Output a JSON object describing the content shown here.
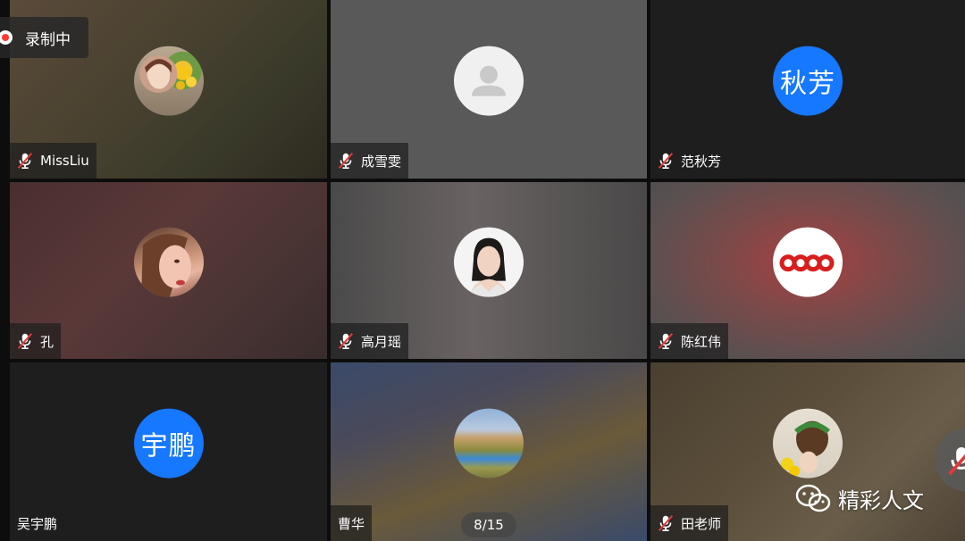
{
  "recording": {
    "label": "录制中",
    "icon": "record-icon"
  },
  "pagination": {
    "label": "8/15"
  },
  "watermark": {
    "text": "精彩人文",
    "icon": "wechat-icon"
  },
  "participants": [
    {
      "name": "MissLiu",
      "avatar_type": "photo",
      "muted": true
    },
    {
      "name": "成雪雯",
      "avatar_type": "default",
      "muted": true
    },
    {
      "name": "范秋芳",
      "avatar_type": "text",
      "avatar_text": "秋芳",
      "muted": true
    },
    {
      "name": "孔",
      "avatar_type": "photo",
      "muted": true
    },
    {
      "name": "高月瑶",
      "avatar_type": "photo",
      "muted": true
    },
    {
      "name": "陈红伟",
      "avatar_type": "photo",
      "muted": true
    },
    {
      "name": "吴宇鹏",
      "avatar_type": "text",
      "avatar_text": "宇鹏",
      "muted": false
    },
    {
      "name": "曹华",
      "avatar_type": "photo",
      "muted": false
    },
    {
      "name": "田老师",
      "avatar_type": "photo",
      "muted": true
    }
  ],
  "colors": {
    "avatar_blue": "#1677ff",
    "mute_red": "#e53935",
    "record_red": "#ff3b30"
  }
}
